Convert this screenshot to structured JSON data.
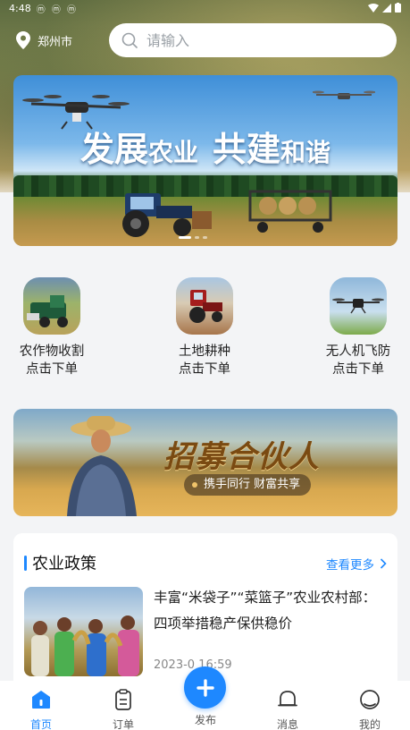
{
  "status_bar": {
    "time": "4:48",
    "icons_text": "ⓜ ⓜ ⓜ"
  },
  "location": {
    "city": "郑州市"
  },
  "search": {
    "placeholder": "请输入"
  },
  "banner": {
    "slogan_part1_big": "发展",
    "slogan_part1_small": "农业",
    "slogan_part2_big": "共建",
    "slogan_part2_small": "和谐",
    "carousel_count": 3,
    "carousel_active": 1
  },
  "services": [
    {
      "line1": "农作物收割",
      "line2": "点击下单"
    },
    {
      "line1": "土地耕种",
      "line2": "点击下单"
    },
    {
      "line1": "无人机飞防",
      "line2": "点击下单"
    }
  ],
  "recruit": {
    "title": "招募合伙人",
    "subtitle": "携手同行 财富共享"
  },
  "policy": {
    "title": "农业政策",
    "more_label": "查看更多",
    "news": [
      {
        "title": "丰富“米袋子”“菜篮子”农业农村部：四项举措稳产保供稳价",
        "date": "2023-0  16:59"
      }
    ]
  },
  "tabbar": {
    "home": "首页",
    "orders": "订单",
    "publish": "发布",
    "messages": "消息",
    "mine": "我的",
    "active": "home"
  },
  "colors": {
    "accent": "#1e88ff",
    "page_bg": "#f3f4f6"
  }
}
